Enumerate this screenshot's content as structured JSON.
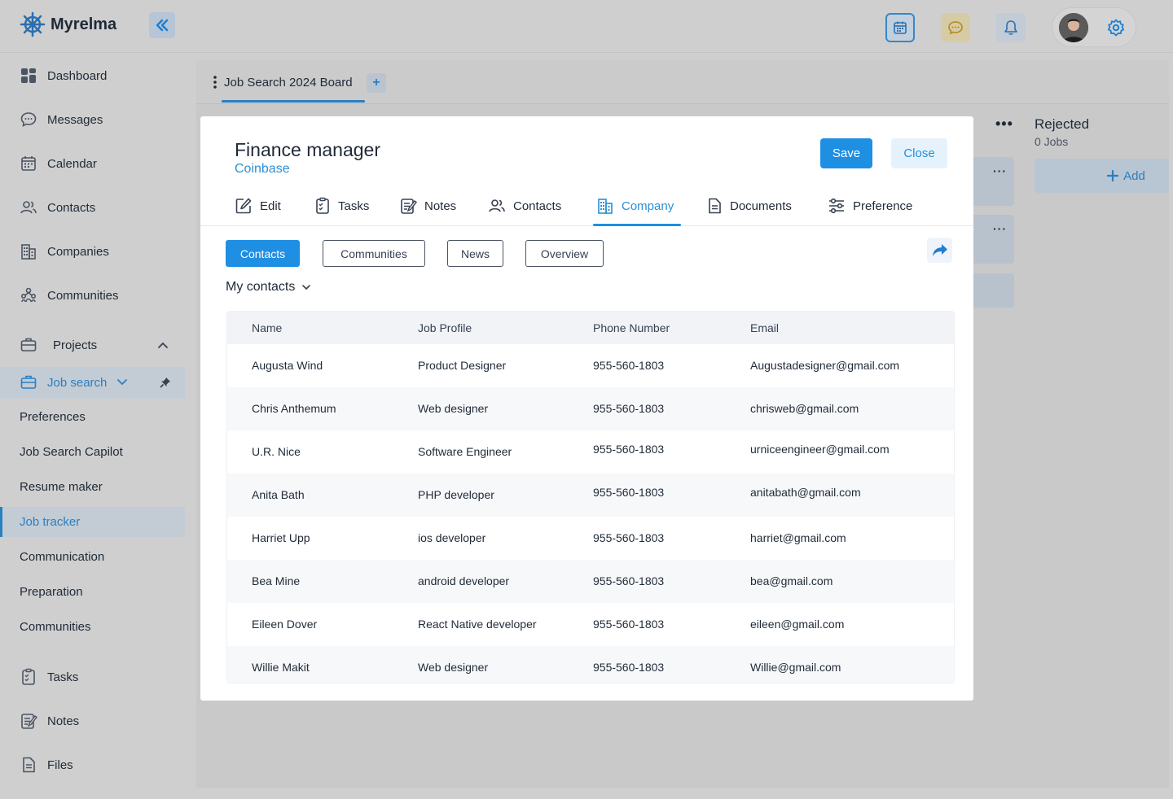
{
  "app": {
    "name": "Myrelma"
  },
  "sidebar": {
    "items": [
      {
        "label": "Dashboard"
      },
      {
        "label": "Messages"
      },
      {
        "label": "Calendar"
      },
      {
        "label": "Contacts"
      },
      {
        "label": "Companies"
      },
      {
        "label": "Communities"
      }
    ],
    "projects_label": "Projects",
    "job_search_label": "Job search",
    "sub_items": [
      {
        "label": "Preferences"
      },
      {
        "label": "Job Search Capilot"
      },
      {
        "label": "Resume maker"
      },
      {
        "label": "Job tracker"
      },
      {
        "label": "Communication"
      },
      {
        "label": "Preparation"
      },
      {
        "label": "Communities"
      }
    ],
    "bottom_items": [
      {
        "label": "Tasks"
      },
      {
        "label": "Notes"
      },
      {
        "label": "Files"
      }
    ]
  },
  "board": {
    "tab_label": "Job Search 2024 Board",
    "add_label": "+",
    "rejected_title": "Rejected",
    "rejected_count": "0 Jobs",
    "add_button": "Add",
    "more_label": "•••",
    "card_more": "···"
  },
  "modal": {
    "title": "Finance manager",
    "company": "Coinbase",
    "save_label": "Save",
    "close_label": "Close",
    "tabs": [
      {
        "label": "Edit"
      },
      {
        "label": "Tasks"
      },
      {
        "label": "Notes"
      },
      {
        "label": "Contacts"
      },
      {
        "label": "Company"
      },
      {
        "label": "Documents"
      },
      {
        "label": "Preference"
      }
    ],
    "active_tab": "Company",
    "subtabs": [
      {
        "label": "Contacts"
      },
      {
        "label": "Communities"
      },
      {
        "label": "News"
      },
      {
        "label": "Overview"
      }
    ],
    "filter_label": "My contacts",
    "table": {
      "headers": [
        "Name",
        "Job Profile",
        "Phone Number",
        "Email"
      ],
      "rows": [
        [
          "Augusta Wind",
          "Product Designer",
          "955-560-1803",
          "Augustadesigner@gmail.com"
        ],
        [
          "Chris Anthemum",
          "Web designer",
          "955-560-1803",
          "chrisweb@gmail.com"
        ],
        [
          "U.R. Nice",
          "Software Engineer",
          "955-560-1803",
          "urniceengineer@gmail.com"
        ],
        [
          "Anita Bath",
          "PHP developer",
          "955-560-1803",
          "anitabath@gmail.com"
        ],
        [
          "Harriet Upp",
          "ios developer",
          "955-560-1803",
          "harriet@gmail.com"
        ],
        [
          "Bea Mine",
          "android developer",
          "955-560-1803",
          "bea@gmail.com"
        ],
        [
          "Eileen Dover",
          "React Native developer",
          "955-560-1803",
          "eileen@gmail.com"
        ],
        [
          "Willie Makit",
          "Web designer",
          "955-560-1803",
          "Willie@gmail.com"
        ]
      ]
    }
  },
  "colors": {
    "accent": "#1f8fe3",
    "brand_dark": "#1f2a37",
    "overlay": "#cfcfcf"
  },
  "icons": [
    "logo-wheel-icon",
    "double-chevron-left-icon",
    "calendar-icon",
    "chat-icon",
    "bell-icon",
    "gear-icon"
  ]
}
